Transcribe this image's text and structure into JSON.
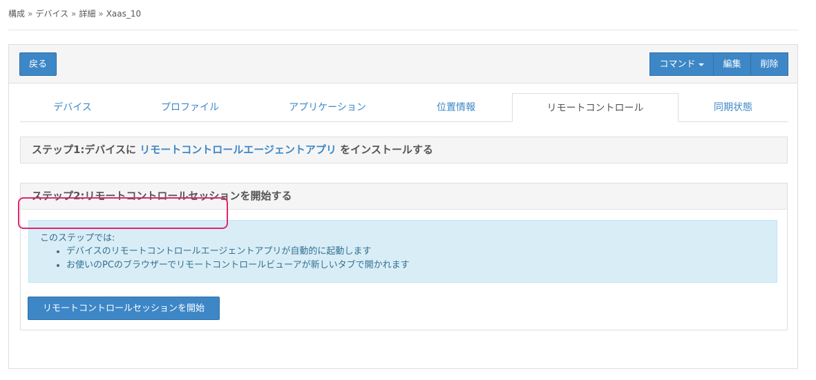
{
  "breadcrumb": {
    "items": [
      "構成",
      "デバイス",
      "詳細",
      "Xaas_10"
    ],
    "separator": "»"
  },
  "toolbar": {
    "back_label": "戻る",
    "command_label": "コマンド",
    "edit_label": "編集",
    "delete_label": "削除"
  },
  "tabs": [
    {
      "label": "デバイス",
      "active": false
    },
    {
      "label": "プロファイル",
      "active": false
    },
    {
      "label": "アプリケーション",
      "active": false
    },
    {
      "label": "位置情報",
      "active": false
    },
    {
      "label": "リモートコントロール",
      "active": true
    },
    {
      "label": "同期状態",
      "active": false
    }
  ],
  "step1": {
    "prefix": "ステップ1:デバイスに",
    "link": "リモートコントロールエージェントアプリ",
    "suffix": "をインストールする"
  },
  "step2": {
    "title": "ステップ2:リモートコントロールセッションを開始する",
    "info_lead": "このステップでは:",
    "info_items": [
      "デバイスのリモートコントロールエージェントアプリが自動的に起動します",
      "お使いのPCのブラウザーでリモートコントロールビューアが新しいタブで開かれます"
    ],
    "start_button": "リモートコントロールセッションを開始"
  },
  "colors": {
    "primary": "#3d87c7",
    "info_bg": "#d9edf7",
    "info_text": "#31708f",
    "highlight": "#e2246f"
  }
}
